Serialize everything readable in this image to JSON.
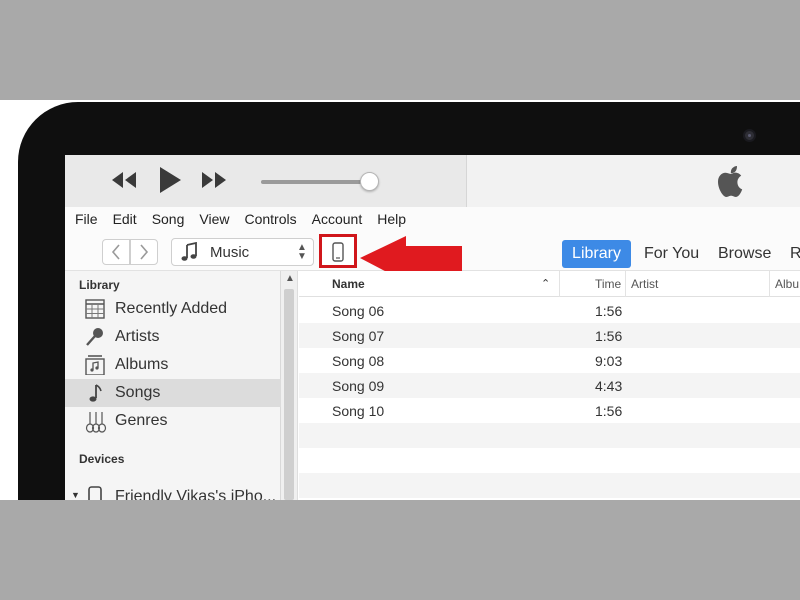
{
  "menu": [
    "File",
    "Edit",
    "Song",
    "View",
    "Controls",
    "Account",
    "Help"
  ],
  "media_selector": {
    "label": "Music"
  },
  "tabs": {
    "library": "Library",
    "for_you": "For You",
    "browse": "Browse",
    "radio": "R"
  },
  "sidebar": {
    "library_heading": "Library",
    "items": [
      {
        "label": "Recently Added",
        "icon": "calendar-grid-icon"
      },
      {
        "label": "Artists",
        "icon": "microphone-icon"
      },
      {
        "label": "Albums",
        "icon": "album-icon"
      },
      {
        "label": "Songs",
        "icon": "music-note-icon",
        "selected": true
      },
      {
        "label": "Genres",
        "icon": "guitars-icon"
      }
    ],
    "devices_heading": "Devices",
    "device": {
      "label": "Friendly Vikas's iPho...",
      "icon": "iphone-icon"
    }
  },
  "table": {
    "columns": {
      "name": "Name",
      "time": "Time",
      "artist": "Artist",
      "album": "Albu"
    },
    "rows": [
      {
        "name": "Song 06",
        "time": "1:56"
      },
      {
        "name": "Song 07",
        "time": "1:56"
      },
      {
        "name": "Song 08",
        "time": "9:03"
      },
      {
        "name": "Song 09",
        "time": "4:43"
      },
      {
        "name": "Song 10",
        "time": "1:56"
      }
    ]
  },
  "colors": {
    "accent": "#3d8ae6",
    "highlight_red": "#d0161b",
    "bezel": "#0f0f0f"
  }
}
